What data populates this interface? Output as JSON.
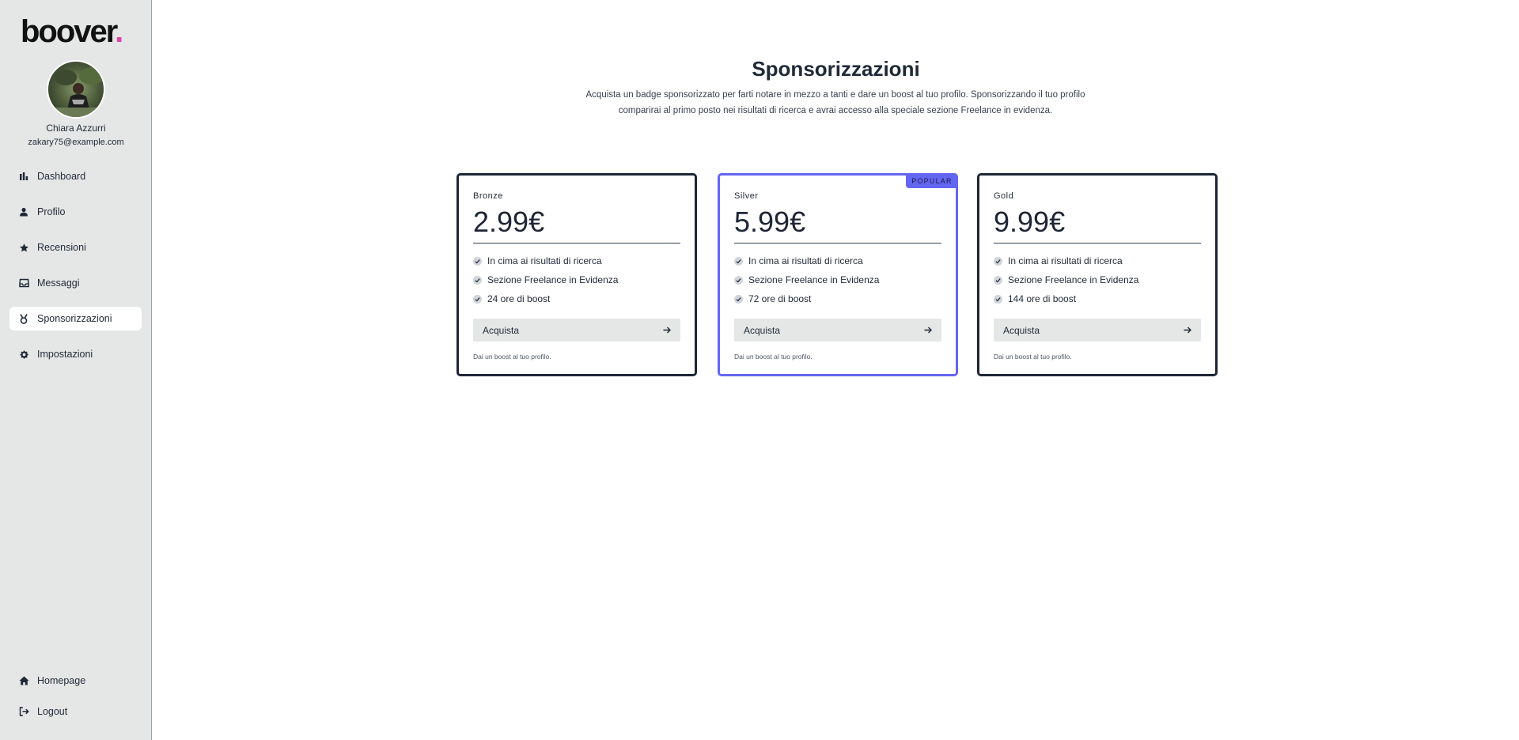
{
  "brand": {
    "name": "boover",
    "dot": ".",
    "accent": "#d946a8"
  },
  "user": {
    "name": "Chiara Azzurri",
    "email": "zakary75@example.com"
  },
  "nav": {
    "items": [
      {
        "label": "Dashboard",
        "icon": "chart-bar-icon"
      },
      {
        "label": "Profilo",
        "icon": "user-icon"
      },
      {
        "label": "Recensioni",
        "icon": "star-icon"
      },
      {
        "label": "Messaggi",
        "icon": "inbox-icon"
      },
      {
        "label": "Sponsorizzazioni",
        "icon": "medal-icon",
        "active": true
      },
      {
        "label": "Impostazioni",
        "icon": "gear-icon"
      }
    ],
    "bottom": [
      {
        "label": "Homepage",
        "icon": "home-icon"
      },
      {
        "label": "Logout",
        "icon": "logout-icon"
      }
    ]
  },
  "page": {
    "title": "Sponsorizzazioni",
    "description": "Acquista un badge sponsorizzato per farti notare in mezzo a tanti e dare un boost al tuo profilo. Sponsorizzando il tuo profilo comparirai al primo posto nei risultati di ricerca e avrai accesso alla speciale sezione Freelance in evidenza."
  },
  "plans": [
    {
      "name": "Bronze",
      "price": "2.99€",
      "features": [
        "In cima ai risultati di ricerca",
        "Sezione Freelance in Evidenza",
        "24 ore di boost"
      ],
      "button": "Acquista",
      "note": "Dai un boost al tuo profilo."
    },
    {
      "name": "Silver",
      "price": "5.99€",
      "badge": "POPULAR",
      "features": [
        "In cima ai risultati di ricerca",
        "Sezione Freelance in Evidenza",
        "72 ore di boost"
      ],
      "button": "Acquista",
      "note": "Dai un boost al tuo profilo."
    },
    {
      "name": "Gold",
      "price": "9.99€",
      "features": [
        "In cima ai risultati di ricerca",
        "Sezione Freelance in Evidenza",
        "144 ore di boost"
      ],
      "button": "Acquista",
      "note": "Dai un boost al tuo profilo."
    }
  ],
  "colors": {
    "popular": "#6366f1",
    "card_border": "#1e2536",
    "sidebar_bg": "#e5e7e6"
  }
}
